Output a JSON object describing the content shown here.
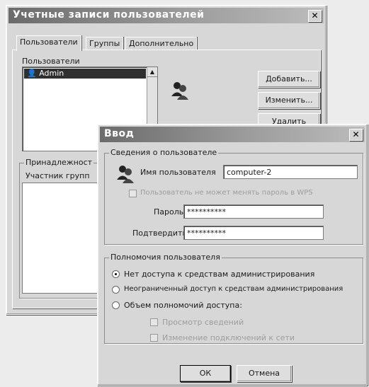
{
  "back_window": {
    "title": "Учетные записи пользователей",
    "tabs": [
      {
        "label": "Пользователи"
      },
      {
        "label": "Группы"
      },
      {
        "label": "Дополнительно"
      }
    ],
    "users_label": "Пользователи",
    "users_list": [
      "Admin"
    ],
    "buttons": {
      "add": "Добавить...",
      "edit": "Изменить...",
      "delete": "Удалить"
    },
    "membership_legend": "Принадлежност",
    "group_member_label": "Участник групп"
  },
  "dialog": {
    "title": "Ввод",
    "user_info_legend": "Сведения о пользователе",
    "username_label": "Имя пользователя",
    "username_value": "computer-2",
    "cannot_change_password_label": "Пользователь не может менять пароль в WPS",
    "password_label": "Пароль",
    "password_value": "**********",
    "confirm_label": "Подтвердить",
    "confirm_value": "**********",
    "permissions_legend": "Полномочия пользователя",
    "options": [
      {
        "label": "Нет доступа к средствам администрирования",
        "selected": true
      },
      {
        "label": "Неограниченный доступ к средствам администрирования",
        "selected": false
      },
      {
        "label": "Объем полномочий доступа:",
        "selected": false
      }
    ],
    "sub_options": [
      {
        "label": "Просмотр сведений"
      },
      {
        "label": "Изменение подключений к сети"
      }
    ],
    "ok": "ОК",
    "cancel": "Отмена"
  }
}
